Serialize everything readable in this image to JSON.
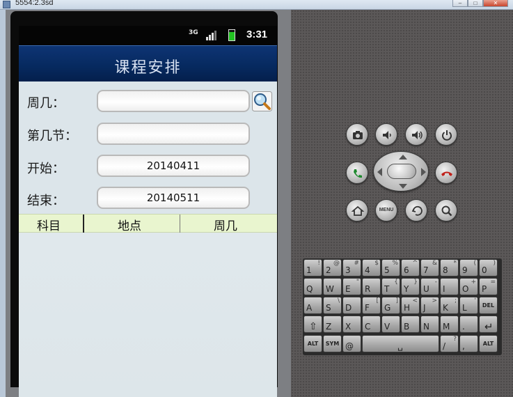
{
  "window": {
    "title": "5554:2.3sd"
  },
  "status_bar": {
    "network": "3G",
    "time": "3:31"
  },
  "app": {
    "title": "课程安排",
    "form": {
      "weekday_label": "周几：",
      "weekday_value": "",
      "period_label": "第几节：",
      "period_value": "",
      "start_label": "开始：",
      "start_value": "20140411",
      "end_label": "结束：",
      "end_value": "20140511"
    },
    "table": {
      "columns": [
        "科目",
        "地点",
        "周几"
      ]
    }
  },
  "emulator": {
    "menu_label": "MENU",
    "keyboard": {
      "rows": [
        [
          [
            "1",
            "!"
          ],
          [
            "2",
            "@"
          ],
          [
            "3",
            "#"
          ],
          [
            "4",
            "$"
          ],
          [
            "5",
            "%"
          ],
          [
            "6",
            "^"
          ],
          [
            "7",
            "&"
          ],
          [
            "8",
            "*"
          ],
          [
            "9",
            "("
          ],
          [
            "0",
            ")"
          ]
        ],
        [
          [
            "Q",
            ""
          ],
          [
            "W",
            ""
          ],
          [
            "E",
            "\""
          ],
          [
            "R",
            ""
          ],
          [
            "T",
            "{"
          ],
          [
            "Y",
            "}"
          ],
          [
            "U",
            "-"
          ],
          [
            "I",
            ""
          ],
          [
            "O",
            "+"
          ],
          [
            "P",
            "="
          ]
        ],
        [
          [
            "A",
            ""
          ],
          [
            "S",
            "\\"
          ],
          [
            "D",
            ""
          ],
          [
            "F",
            "["
          ],
          [
            "G",
            "]"
          ],
          [
            "H",
            "<"
          ],
          [
            "J",
            ">"
          ],
          [
            "K",
            ";"
          ],
          [
            "L",
            "'"
          ],
          [
            "DEL",
            ""
          ]
        ],
        [
          [
            "⇧",
            ""
          ],
          [
            "Z",
            ""
          ],
          [
            "X",
            ""
          ],
          [
            "C",
            ""
          ],
          [
            "V",
            ""
          ],
          [
            "B",
            ""
          ],
          [
            "N",
            ""
          ],
          [
            "M",
            ""
          ],
          [
            ".",
            ""
          ],
          [
            "↵",
            ""
          ]
        ],
        [
          [
            "ALT",
            ""
          ],
          [
            "SYM",
            ""
          ],
          [
            "@",
            ""
          ],
          [
            "␣",
            ""
          ],
          [
            "/",
            "?"
          ],
          [
            ",",
            ""
          ],
          [
            "ALT",
            ""
          ]
        ]
      ]
    }
  }
}
